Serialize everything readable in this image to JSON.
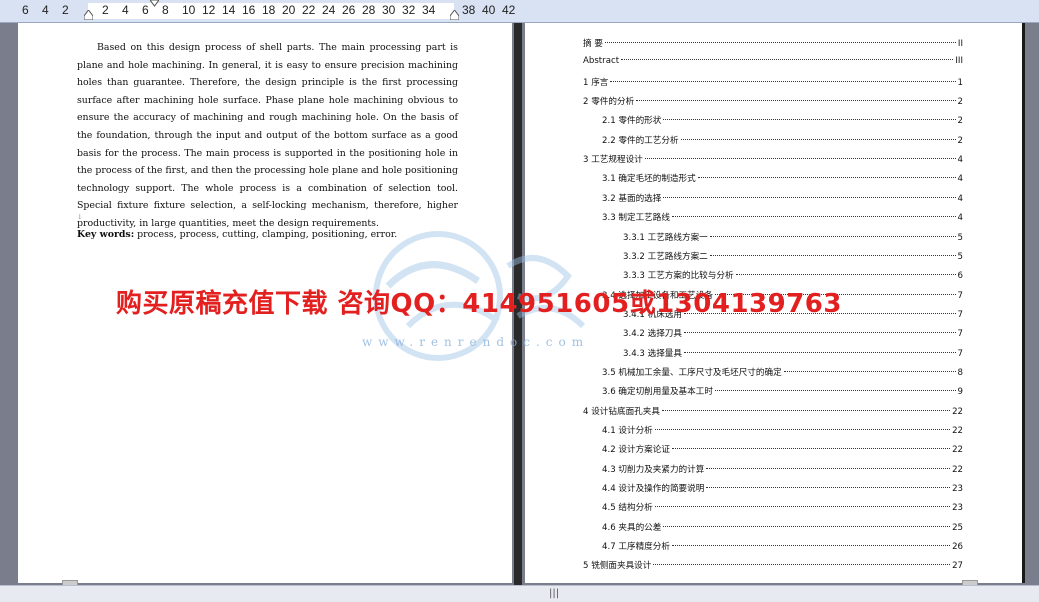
{
  "ruler": {
    "numbers": [
      "6",
      "4",
      "2",
      "2",
      "4",
      "6",
      "8",
      "10",
      "12",
      "14",
      "16",
      "18",
      "20",
      "22",
      "24",
      "26",
      "28",
      "30",
      "32",
      "34",
      "38",
      "40",
      "42"
    ]
  },
  "abstract": {
    "text": "Based on this design process of shell parts. The main processing part is plane and hole machining. In general, it is easy to ensure precision machining holes than guarantee. Therefore, the design principle is the first processing surface after machining hole surface. Phase plane hole machining obvious to ensure the accuracy of machining and rough machining hole. On the basis of the foundation, through the input and output of the bottom surface as a good basis for the process. The main process is supported in the positioning hole in the process of the first, and then the processing hole plane and hole positioning technology support. The whole process is a combination of selection tool. Special fixture fixture selection, a self-locking mechanism, therefore, higher productivity, in large quantities, meet the design requirements.",
    "keywords_label": "Key words:",
    "keywords_value": " process, process, cutting, clamping, positioning, error."
  },
  "banner": {
    "text": "购买原稿充值下载  咨询QQ：414951605或1304139763"
  },
  "watermark": {
    "url": "www.renrendoc.com"
  },
  "toc": [
    {
      "label": "摘    要",
      "page": "II"
    },
    {
      "label": "Abstract",
      "page": "III"
    },
    {
      "label": "1    序言",
      "page": "1"
    },
    {
      "label": "2    零件的分析",
      "page": "2"
    },
    {
      "label": "2.1  零件的形状",
      "page": "2"
    },
    {
      "label": "2.2  零件的工艺分析",
      "page": "2"
    },
    {
      "label": "3    工艺规程设计",
      "page": "4"
    },
    {
      "label": "3.1  确定毛坯的制造形式",
      "page": "4"
    },
    {
      "label": "3.2  基面的选择",
      "page": "4"
    },
    {
      "label": "3.3  制定工艺路线",
      "page": "4"
    },
    {
      "label": "3.3.1  工艺路线方案一",
      "page": "5"
    },
    {
      "label": "3.3.2  工艺路线方案二",
      "page": "5"
    },
    {
      "label": "3.3.3  工艺方案的比较与分析",
      "page": "6"
    },
    {
      "label": "3.4  选择加工设备和工艺设备",
      "page": "7"
    },
    {
      "label": "3.4.1  机床选用",
      "page": "7"
    },
    {
      "label": "3.4.2  选择刀具",
      "page": "7"
    },
    {
      "label": "3.4.3  选择量具",
      "page": "7"
    },
    {
      "label": "3.5  机械加工余量、工序尺寸及毛坯尺寸的确定",
      "page": "8"
    },
    {
      "label": "3.6  确定切削用量及基本工时",
      "page": "9"
    },
    {
      "label": "4  设计钻底面孔夹具",
      "page": "22"
    },
    {
      "label": "4.1 设计分析",
      "page": "22"
    },
    {
      "label": "4.2 设计方案论证",
      "page": "22"
    },
    {
      "label": "4.3 切削力及夹紧力的计算",
      "page": "22"
    },
    {
      "label": "4.4  设计及操作的简要说明",
      "page": "23"
    },
    {
      "label": "4.5  结构分析",
      "page": "23"
    },
    {
      "label": "4.6  夹具的公差",
      "page": "25"
    },
    {
      "label": "4.7  工序精度分析",
      "page": "26"
    },
    {
      "label": "5    铣侧面夹具设计",
      "page": "27"
    }
  ]
}
